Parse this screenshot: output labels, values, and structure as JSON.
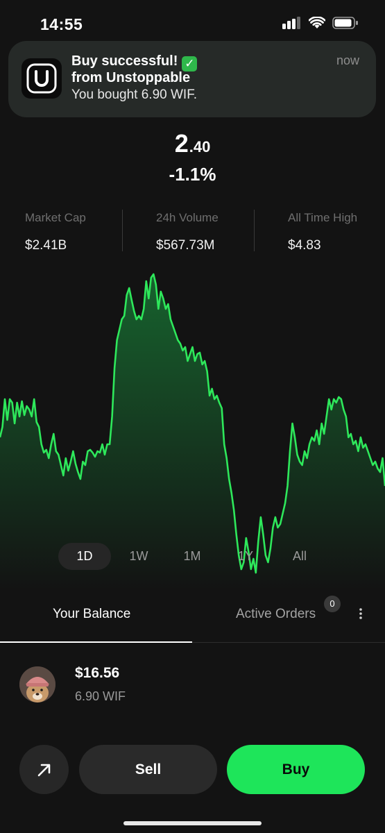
{
  "status_bar": {
    "time": "14:55",
    "icons": [
      "cellular-signal-icon",
      "wifi-icon",
      "battery-icon"
    ]
  },
  "notification": {
    "title": "Buy successful!",
    "title_emoji": "✓",
    "subtitle": "from Unstoppable",
    "body": "You bought 6.90 WIF.",
    "time": "now",
    "app_icon": "unstoppable-app-icon"
  },
  "price": {
    "main": "2",
    "decimals": ".40",
    "change": "-1.1%"
  },
  "stats": [
    {
      "label": "Market Cap",
      "value": "$2.41B"
    },
    {
      "label": "24h Volume",
      "value": "$567.73M"
    },
    {
      "label": "All Time High",
      "value": "$4.83"
    }
  ],
  "chart_data": {
    "type": "area",
    "line_color": "#2ee85b",
    "values": [
      630,
      615,
      575,
      605,
      575,
      580,
      610,
      580,
      600,
      578,
      598,
      585,
      590,
      600,
      575,
      608,
      615,
      640,
      652,
      648,
      660,
      640,
      625,
      650,
      655,
      670,
      685,
      660,
      678,
      665,
      650,
      668,
      680,
      690,
      665,
      670,
      650,
      648,
      652,
      658,
      650,
      652,
      640,
      655,
      640,
      640,
      600,
      530,
      490,
      475,
      460,
      455,
      425,
      415,
      432,
      448,
      460,
      455,
      460,
      445,
      405,
      430,
      400,
      395,
      410,
      445,
      420,
      430,
      445,
      438,
      460,
      470,
      480,
      490,
      495,
      505,
      500,
      520,
      510,
      500,
      520,
      510,
      508,
      525,
      520,
      535,
      570,
      560,
      575,
      570,
      580,
      588,
      640,
      660,
      690,
      710,
      735,
      770,
      800,
      820,
      810,
      775,
      795,
      820,
      805,
      825,
      780,
      745,
      770,
      800,
      810,
      790,
      760,
      745,
      760,
      755,
      740,
      725,
      700,
      650,
      610,
      630,
      655,
      665,
      670,
      650,
      660,
      640,
      630,
      635,
      620,
      640,
      610,
      625,
      600,
      575,
      590,
      575,
      580,
      572,
      575,
      590,
      600,
      630,
      625,
      640,
      635,
      650,
      630,
      645,
      640,
      650,
      660,
      670,
      665,
      675,
      680,
      660,
      700
    ],
    "timeframes": [
      "1D",
      "1W",
      "1M",
      "1Y",
      "All"
    ],
    "selected_timeframe": "1D"
  },
  "tabs": {
    "balance": "Your Balance",
    "orders": "Active Orders",
    "orders_count": "0"
  },
  "holding": {
    "usd_value": "$16.56",
    "amount": "6.90 WIF",
    "avatar": "dogwifhat-avatar"
  },
  "actions": {
    "sell": "Sell",
    "buy": "Buy",
    "send_icon": "arrow-up-right-icon"
  },
  "colors": {
    "background": "#131313",
    "accent": "#1ee55a",
    "chart_line": "#2ee85b"
  }
}
